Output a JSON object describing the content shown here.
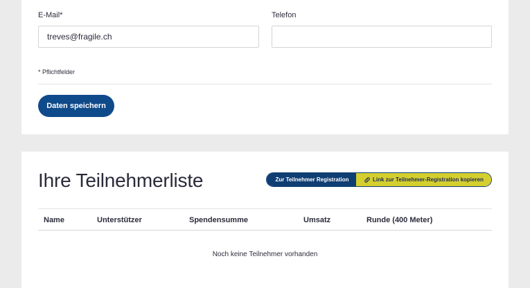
{
  "form": {
    "email": {
      "label": "E-Mail*",
      "value": "treves@fragile.ch"
    },
    "phone": {
      "label": "Telefon",
      "value": ""
    },
    "required_note": "* Pflichtfelder",
    "save_label": "Daten speichern"
  },
  "participants": {
    "title": "Ihre Teilnehmerliste",
    "registration_button": "Zur Teilnehmer Registration",
    "copy_link_button": "Link zur Teilnehmer-Registration kopieren",
    "columns": [
      "Name",
      "Unterstützer",
      "Spendensumme",
      "Umsatz",
      "Runde (400 Meter)"
    ],
    "empty_text": "Noch keine Teilnehmer vorhanden"
  },
  "colors": {
    "primary": "#0f4a8a",
    "accent": "#d4cf2f",
    "background": "#ebebeb"
  }
}
